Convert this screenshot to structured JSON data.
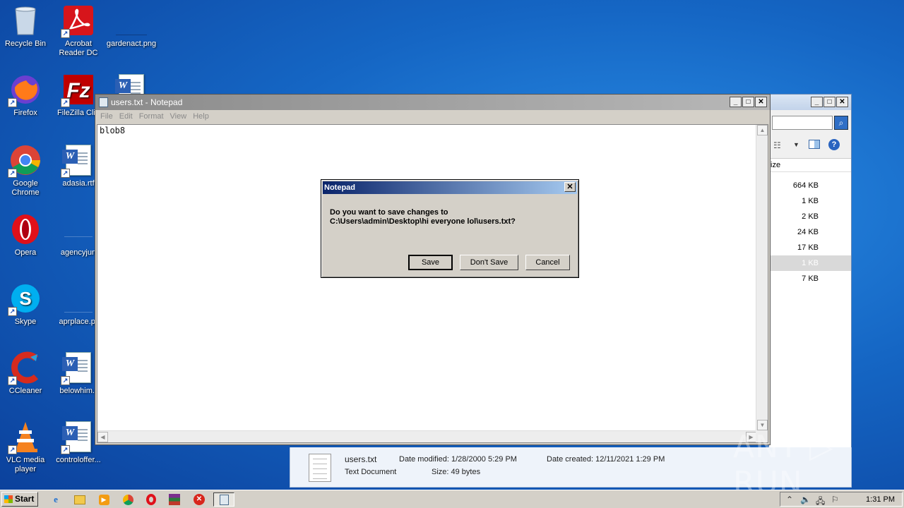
{
  "desktop": {
    "icons": [
      {
        "label": "Recycle Bin"
      },
      {
        "label": "Acrobat Reader DC"
      },
      {
        "label": "gardenact.png"
      },
      {
        "label": "Firefox"
      },
      {
        "label": "FileZilla Clie"
      },
      {
        "label": "Google Chrome"
      },
      {
        "label": "adasia.rtf"
      },
      {
        "label": "Opera"
      },
      {
        "label": "agencyjun"
      },
      {
        "label": "Skype"
      },
      {
        "label": "aprplace.pr"
      },
      {
        "label": "CCleaner"
      },
      {
        "label": "belowhim.r"
      },
      {
        "label": "VLC media player"
      },
      {
        "label": "controloffer..."
      }
    ]
  },
  "explorer": {
    "column_header": "ize",
    "sizes": [
      "664 KB",
      "1 KB",
      "2 KB",
      "24 KB",
      "17 KB",
      "1 KB",
      "7 KB"
    ],
    "selected_index": 5,
    "details": {
      "filename": "users.txt",
      "filetype": "Text Document",
      "date_modified_label": "Date modified: 1/28/2000 5:29 PM",
      "size_label": "Size:  49 bytes",
      "date_created_label": "Date created: 12/11/2021 1:29 PM"
    }
  },
  "notepad": {
    "title": "users.txt - Notepad",
    "menu": [
      "File",
      "Edit",
      "Format",
      "View",
      "Help"
    ],
    "content": "blob8"
  },
  "dialog": {
    "title": "Notepad",
    "message_line1": "Do you want to save changes to",
    "message_line2": "C:\\Users\\admin\\Desktop\\hi everyone lol\\users.txt?",
    "save_label": "Save",
    "dont_save_label": "Don't Save",
    "cancel_label": "Cancel"
  },
  "taskbar": {
    "start_label": "Start",
    "clock": "1:31 PM"
  },
  "watermark": "ANY ▷ RUN",
  "colors": {
    "desktop_bg": "#1566c4",
    "dialog_title": "#0a246a",
    "window_face": "#d4d0c8"
  }
}
